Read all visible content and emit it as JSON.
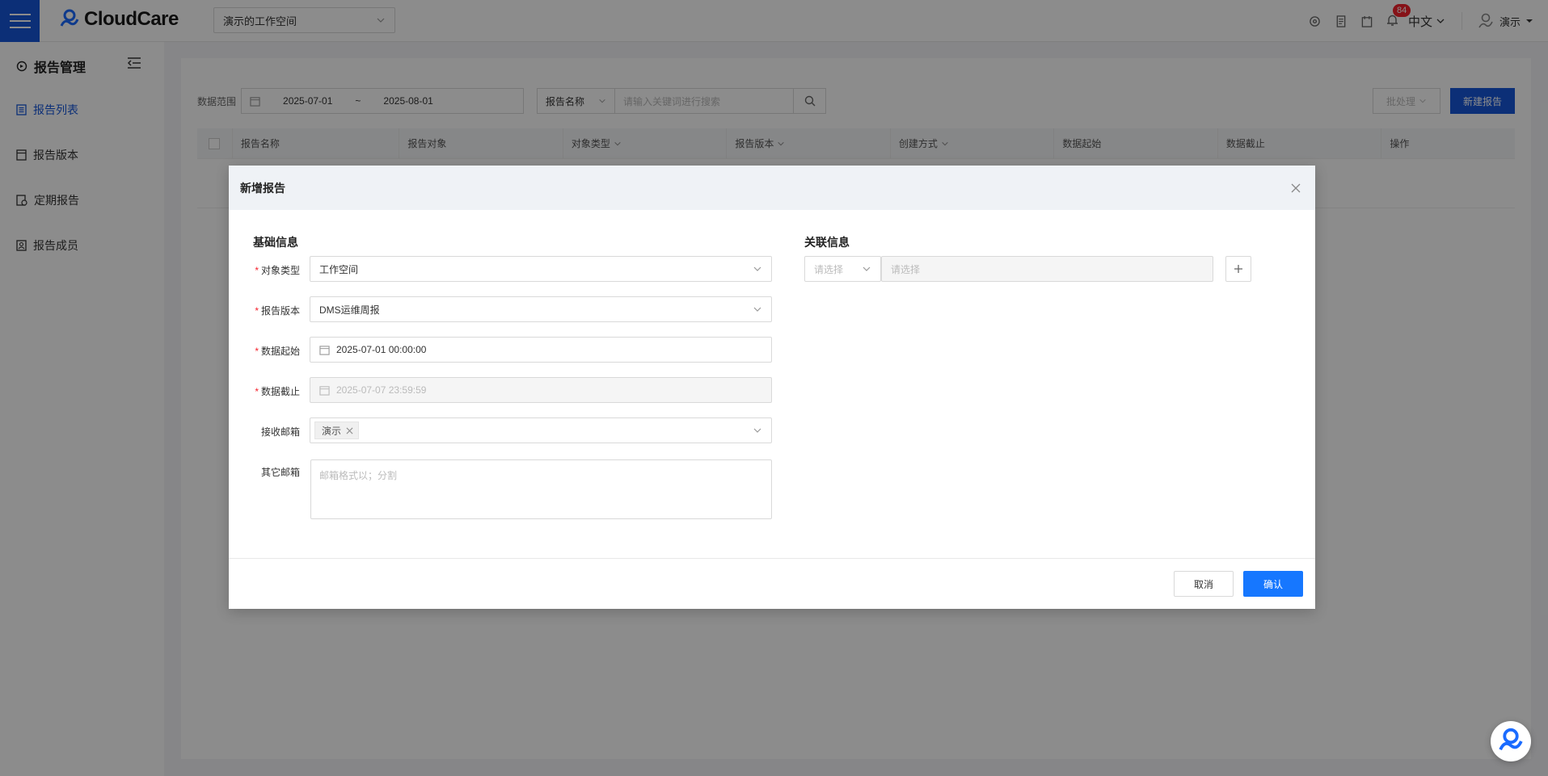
{
  "topbar": {
    "logo_text": "CloudCare",
    "workspace": "演示的工作空间",
    "notification_count": "84",
    "language": "中文",
    "user": "演示"
  },
  "sidebar": {
    "title": "报告管理",
    "items": [
      {
        "label": "报告列表",
        "icon": "list-icon",
        "active": true
      },
      {
        "label": "报告版本",
        "icon": "document-icon",
        "active": false
      },
      {
        "label": "定期报告",
        "icon": "schedule-icon",
        "active": false
      },
      {
        "label": "报告成员",
        "icon": "members-icon",
        "active": false
      }
    ]
  },
  "filters": {
    "date_range_label": "数据范围",
    "date_start": "2025-07-01",
    "date_sep": "~",
    "date_end": "2025-08-01",
    "search_field": "报告名称",
    "search_placeholder": "请输入关键词进行搜索",
    "batch_label": "批处理",
    "new_report_label": "新建报告"
  },
  "table": {
    "columns": [
      "报告名称",
      "报告对象",
      "对象类型",
      "报告版本",
      "创建方式",
      "数据起始",
      "数据截止",
      "操作"
    ]
  },
  "modal": {
    "title": "新增报告",
    "basic_section": "基础信息",
    "related_section": "关联信息",
    "fields": {
      "object_type_label": "对象类型",
      "object_type_value": "工作空间",
      "version_label": "报告版本",
      "version_value": "DMS运维周报",
      "start_label": "数据起始",
      "start_value": "2025-07-01 00:00:00",
      "end_label": "数据截止",
      "end_value": "2025-07-07 23:59:59",
      "email_label": "接收邮箱",
      "email_tag": "演示",
      "other_email_label": "其它邮箱",
      "other_email_placeholder": "邮箱格式以；分割"
    },
    "related": {
      "type_placeholder": "请选择",
      "value_placeholder": "请选择"
    },
    "cancel_label": "取消",
    "confirm_label": "确认"
  }
}
